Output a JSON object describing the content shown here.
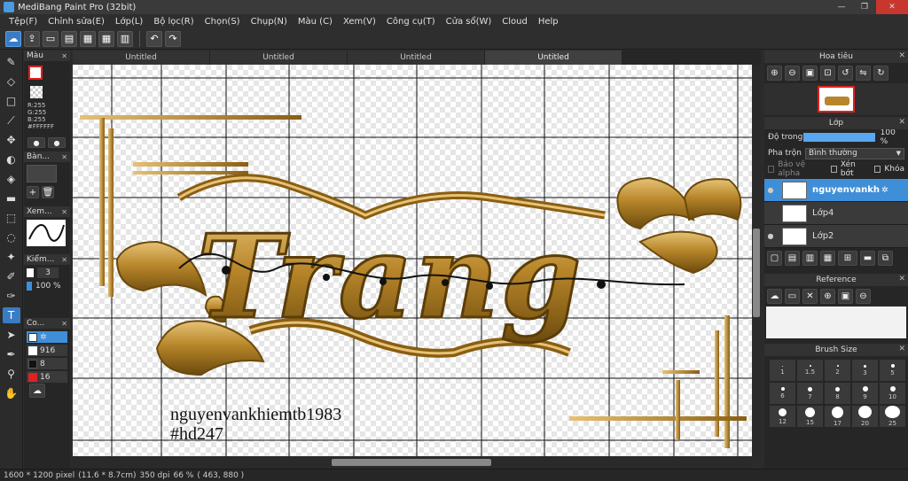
{
  "window": {
    "title": "MediBang Paint Pro (32bit)",
    "minimize_glyph": "—",
    "restore_glyph": "❐",
    "close_glyph": "✕"
  },
  "menu": [
    "Tệp(F)",
    "Chỉnh sửa(E)",
    "Lớp(L)",
    "Bộ lọc(R)",
    "Chọn(S)",
    "Chụp(N)",
    "Màu (C)",
    "Xem(V)",
    "Công cụ(T)",
    "Cửa sổ(W)",
    "Cloud",
    "Help"
  ],
  "tabs": [
    "Untitled",
    "Untitled",
    "Untitled",
    "Untitled"
  ],
  "left_panels": {
    "color": {
      "title": "Màu",
      "r": "R:255",
      "g": "G:255",
      "b": "B:255",
      "hex": "#FFFFFF"
    },
    "brush": {
      "title": "Bàn..."
    },
    "view": {
      "title": "Xem..."
    },
    "check": {
      "title": "Kiểm...",
      "value": "3",
      "opacity": "100 %"
    },
    "colors": {
      "title": "Co...",
      "items": [
        "916",
        "8",
        "16"
      ]
    }
  },
  "canvas": {
    "watermark_name": "nguyenvankhiemtb1983",
    "watermark_tag": "#hd247",
    "artwork_text": "Trang"
  },
  "status": {
    "size": "1600 * 1200 pixel",
    "cm": "(11.6 * 8.7cm)",
    "dpi": "350 dpi",
    "zoom": "66 %",
    "coords": "( 463, 880 )"
  },
  "navigator": {
    "title": "Hoa tiêu"
  },
  "layer_panel": {
    "title": "Lớp",
    "opacity_label": "Độ trong",
    "opacity_value": "100 %",
    "opacity_fraction": 1.0,
    "blend_label": "Pha trộn",
    "blend_value": "Bình thường",
    "protect_alpha": "Bảo vệ alpha",
    "clipping": "Xén bớt",
    "lock": "Khóa",
    "layers": [
      "nguyenvankh",
      "Lớp4",
      "Lớp2"
    ]
  },
  "reference": {
    "title": "Reference"
  },
  "brush_size": {
    "title": "Brush Size",
    "sizes": [
      "1",
      "1.5",
      "2",
      "3",
      "5",
      "6",
      "7",
      "8",
      "9",
      "10",
      "12",
      "15",
      "17",
      "20",
      "25",
      "",
      "",
      "",
      "",
      ""
    ]
  },
  "colors": {
    "accent": "#3f8fd8",
    "gold": "#b8862a",
    "gold_dark": "#6b4a0d",
    "gold_light": "#e6c275"
  }
}
